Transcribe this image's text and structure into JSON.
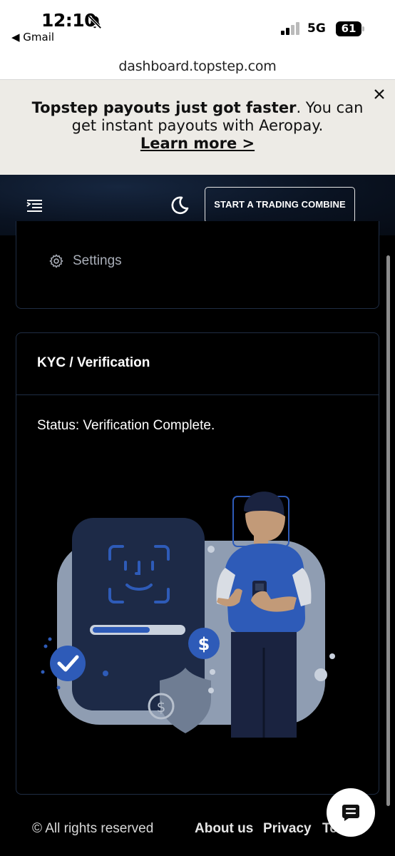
{
  "status_bar": {
    "time": "12:10",
    "back_app": "◀ Gmail",
    "network": "5G",
    "battery": "61"
  },
  "browser": {
    "url": "dashboard.topstep.com"
  },
  "banner": {
    "bold_text": "Topstep payouts just got faster",
    "rest_text": ". You can get instant payouts with Aeropay.",
    "link": "Learn more >"
  },
  "header": {
    "cta_label": "START A TRADING COMBINE"
  },
  "menu": {
    "settings_label": "Settings"
  },
  "kyc": {
    "title": "KYC / Verification",
    "status": "Status: Verification Complete."
  },
  "footer": {
    "copyright": "© All rights reserved",
    "links": [
      "About us",
      "Privacy",
      "Te"
    ]
  },
  "colors": {
    "accent_blue": "#2e5bb8",
    "card_border": "#1f2d44",
    "banner_bg": "#edebe6"
  },
  "icons": {
    "notification": "bell-slash-icon",
    "menu": "menu-indent-icon",
    "theme": "moon-icon",
    "settings": "gear-icon",
    "close": "close-icon",
    "chat": "chat-icon"
  }
}
